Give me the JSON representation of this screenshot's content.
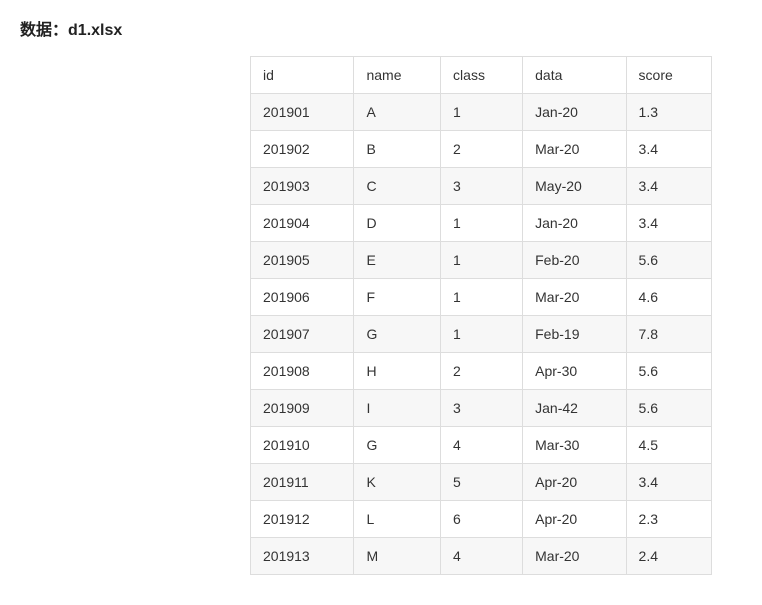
{
  "title_prefix": "数据：",
  "title_file": "d1.xlsx",
  "table": {
    "headers": [
      "id",
      "name",
      "class",
      "data",
      "score"
    ],
    "rows": [
      {
        "id": "201901",
        "name": "A",
        "class": "1",
        "data": "Jan-20",
        "score": "1.3"
      },
      {
        "id": "201902",
        "name": "B",
        "class": "2",
        "data": "Mar-20",
        "score": "3.4"
      },
      {
        "id": "201903",
        "name": "C",
        "class": "3",
        "data": "May-20",
        "score": "3.4"
      },
      {
        "id": "201904",
        "name": "D",
        "class": "1",
        "data": "Jan-20",
        "score": "3.4"
      },
      {
        "id": "201905",
        "name": "E",
        "class": "1",
        "data": "Feb-20",
        "score": "5.6"
      },
      {
        "id": "201906",
        "name": "F",
        "class": "1",
        "data": "Mar-20",
        "score": "4.6"
      },
      {
        "id": "201907",
        "name": "G",
        "class": "1",
        "data": "Feb-19",
        "score": "7.8"
      },
      {
        "id": "201908",
        "name": "H",
        "class": "2",
        "data": "Apr-30",
        "score": "5.6"
      },
      {
        "id": "201909",
        "name": "I",
        "class": "3",
        "data": "Jan-42",
        "score": "5.6"
      },
      {
        "id": "201910",
        "name": "G",
        "class": "4",
        "data": "Mar-30",
        "score": "4.5"
      },
      {
        "id": "201911",
        "name": "K",
        "class": "5",
        "data": "Apr-20",
        "score": "3.4"
      },
      {
        "id": "201912",
        "name": "L",
        "class": "6",
        "data": "Apr-20",
        "score": "2.3"
      },
      {
        "id": "201913",
        "name": "M",
        "class": "4",
        "data": "Mar-20",
        "score": "2.4"
      }
    ]
  }
}
